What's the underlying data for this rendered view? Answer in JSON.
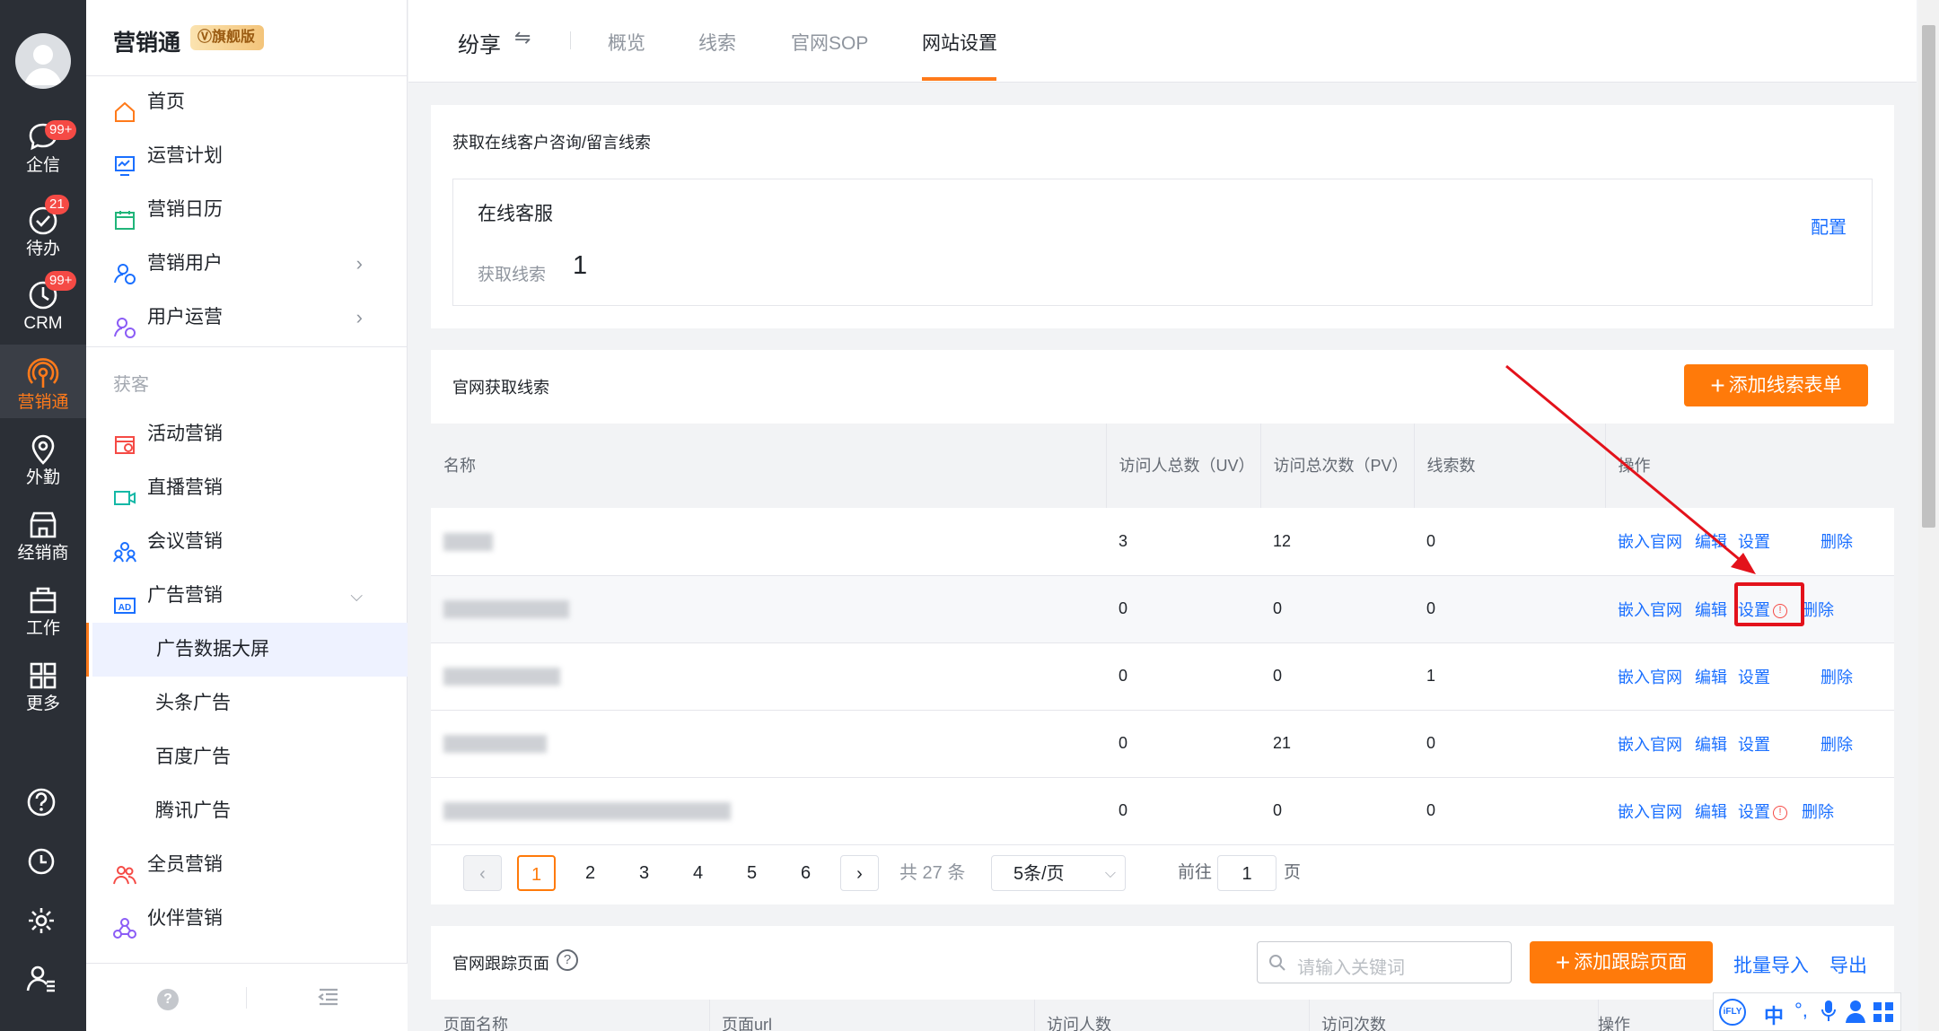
{
  "rail": {
    "items": [
      {
        "label": "企信",
        "badge": "99+"
      },
      {
        "label": "待办",
        "badge": "21"
      },
      {
        "label": "CRM",
        "badge": "99+"
      },
      {
        "label": "营销通",
        "badge": ""
      },
      {
        "label": "外勤",
        "badge": ""
      },
      {
        "label": "经销商",
        "badge": ""
      },
      {
        "label": "工作",
        "badge": ""
      },
      {
        "label": "更多",
        "badge": ""
      }
    ],
    "accent": "#ff7a1a"
  },
  "sidebar": {
    "brand": "营销通",
    "brand_tag": "旗舰版",
    "section_label": "获客",
    "items": [
      {
        "label": "首页"
      },
      {
        "label": "运营计划"
      },
      {
        "label": "营销日历"
      },
      {
        "label": "营销用户"
      },
      {
        "label": "用户运营"
      }
    ],
    "acq_items": [
      {
        "label": "活动营销"
      },
      {
        "label": "直播营销"
      },
      {
        "label": "会议营销"
      },
      {
        "label": "广告营销"
      }
    ],
    "ad_sub": [
      {
        "label": "广告数据大屏"
      },
      {
        "label": "头条广告"
      },
      {
        "label": "百度广告"
      },
      {
        "label": "腾讯广告"
      }
    ],
    "more_items": [
      {
        "label": "全员营销"
      },
      {
        "label": "伙伴营销"
      }
    ]
  },
  "topbar": {
    "title": "纷享",
    "swap": "⇋",
    "tabs": [
      "概览",
      "线索",
      "官网SOP",
      "网站设置"
    ],
    "active_tab": "网站设置"
  },
  "online": {
    "section_title": "获取在线客户咨询/留言线索",
    "box_title": "在线客服",
    "leads_label": "获取线索",
    "leads_value": "1",
    "config_link": "配置"
  },
  "site_leads": {
    "section_title": "官网获取线索",
    "add_button": "添加线索表单",
    "columns": [
      "名称",
      "访问人总数（UV）",
      "访问总次数（PV）",
      "线索数",
      "操作"
    ],
    "rows": [
      {
        "uv": "3",
        "pv": "12",
        "leads": "0",
        "warn": false
      },
      {
        "uv": "0",
        "pv": "0",
        "leads": "0",
        "warn": true
      },
      {
        "uv": "0",
        "pv": "0",
        "leads": "1",
        "warn": false
      },
      {
        "uv": "0",
        "pv": "21",
        "leads": "0",
        "warn": false
      },
      {
        "uv": "0",
        "pv": "0",
        "leads": "0",
        "warn": true
      }
    ],
    "ops": {
      "embed": "嵌入官网",
      "edit": "编辑",
      "settings": "设置",
      "delete": "删除"
    },
    "pager": {
      "pages": [
        "1",
        "2",
        "3",
        "4",
        "5",
        "6"
      ],
      "current": "1",
      "total": "共 27 条",
      "page_size": "5条/页",
      "goto_label": "前往",
      "goto_value": "1",
      "goto_suffix": "页"
    }
  },
  "tracking": {
    "section_title": "官网跟踪页面",
    "search_placeholder": "请输入关键词",
    "add_button": "添加跟踪页面",
    "import_link": "批量导入",
    "export_link": "导出",
    "columns": [
      "页面名称",
      "页面url",
      "访问人数",
      "访问次数",
      "操作"
    ]
  },
  "floatbar": {
    "zh": "中"
  }
}
